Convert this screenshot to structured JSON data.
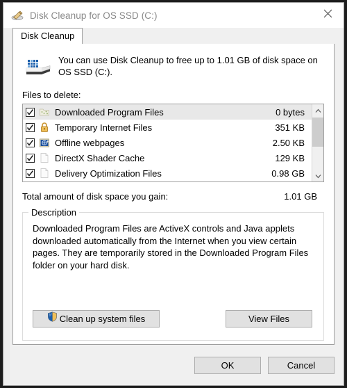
{
  "window": {
    "title": "Disk Cleanup for OS SSD (C:)",
    "title_icon": "disk-cleanup-icon",
    "close_icon": "close-icon"
  },
  "tabs": [
    {
      "label": "Disk Cleanup",
      "active": true
    }
  ],
  "header": {
    "icon": "hard-drive-icon",
    "message": "You can use Disk Cleanup to free up to 1.01 GB of disk space on OS SSD (C:).",
    "files_to_delete_label": "Files to delete:"
  },
  "file_list": {
    "columns": [
      "name",
      "size"
    ],
    "rows": [
      {
        "checked": true,
        "icon": "downloaded-program-files-icon",
        "name": "Downloaded Program Files",
        "size": "0 bytes",
        "selected": true
      },
      {
        "checked": true,
        "icon": "padlock-icon",
        "name": "Temporary Internet Files",
        "size": "351 KB",
        "selected": false
      },
      {
        "checked": true,
        "icon": "offline-webpages-icon",
        "name": "Offline webpages",
        "size": "2.50 KB",
        "selected": false
      },
      {
        "checked": true,
        "icon": "document-icon",
        "name": "DirectX Shader Cache",
        "size": "129 KB",
        "selected": false
      },
      {
        "checked": true,
        "icon": "document-icon",
        "name": "Delivery Optimization Files",
        "size": "0.98 GB",
        "selected": false
      }
    ],
    "scrollbar": {
      "up_icon": "chevron-up-icon",
      "down_icon": "chevron-down-icon"
    }
  },
  "total": {
    "label": "Total amount of disk space you gain:",
    "value": "1.01 GB"
  },
  "description": {
    "legend": "Description",
    "text": "Downloaded Program Files are ActiveX controls and Java applets downloaded automatically from the Internet when you view certain pages. They are temporarily stored in the Downloaded Program Files folder on your hard disk.",
    "cleanup_system_files_label": "Clean up system files",
    "cleanup_system_files_icon": "uac-shield-icon",
    "view_files_label": "View Files"
  },
  "footer": {
    "ok_label": "OK",
    "cancel_label": "Cancel"
  },
  "colors": {
    "window_bg": "#f0f0f0",
    "page_bg": "#ffffff",
    "button_face": "#e1e1e1",
    "button_border": "#adadad",
    "title_text": "#8a8a8a",
    "selection": "#e8e8e8",
    "scrollbar_thumb": "#cdcdcd",
    "shield_blue": "#1b5eab",
    "shield_gold": "#f0c05a"
  }
}
